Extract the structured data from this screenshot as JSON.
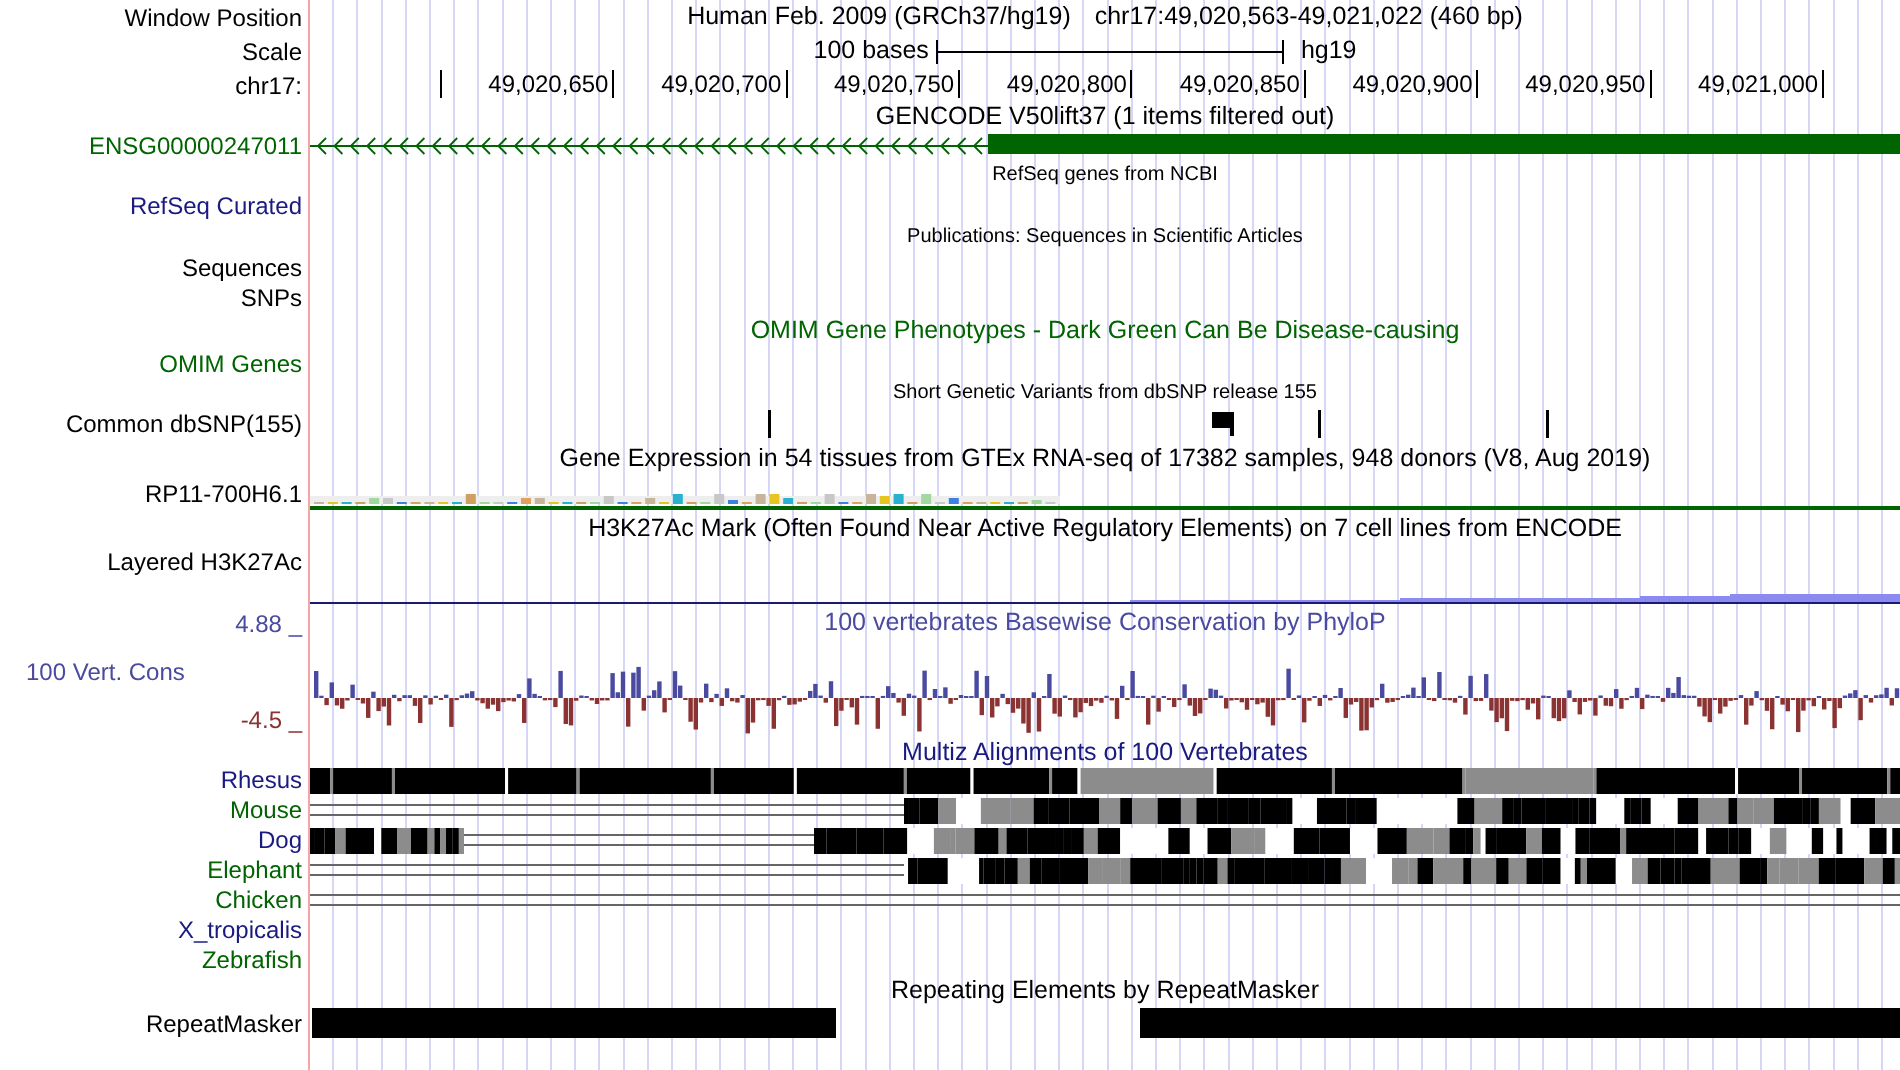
{
  "header": {
    "label": "Window Position",
    "assembly": "Human Feb. 2009 (GRCh37/hg19)",
    "position": "chr17:49,020,563-49,021,022 (460 bp)"
  },
  "scale": {
    "label": "Scale",
    "bar_label": "100 bases",
    "assembly": "hg19"
  },
  "ruler": {
    "label": "chr17:",
    "ticks": [
      "49,020,650",
      "49,020,700",
      "49,020,750",
      "49,020,800",
      "49,020,850",
      "49,020,900",
      "49,020,950",
      "49,021,000"
    ]
  },
  "rows": [
    {
      "kind": "title",
      "title": "GENCODE V50lift37 (1 items filtered out)"
    },
    {
      "kind": "gene",
      "label": "ENSG00000247011",
      "color": "#006400"
    },
    {
      "kind": "small_title",
      "title": "RefSeq genes from NCBI"
    },
    {
      "kind": "label",
      "label": "RefSeq Curated",
      "color": "#1a1a80"
    },
    {
      "kind": "small_title",
      "title": "Publications: Sequences in Scientific Articles"
    },
    {
      "kind": "label",
      "label": "Sequences",
      "color": "#000000"
    },
    {
      "kind": "label",
      "label": "SNPs",
      "color": "#000000"
    },
    {
      "kind": "title",
      "title": "OMIM Gene Phenotypes - Dark Green Can Be Disease-causing",
      "color": "#006400"
    },
    {
      "kind": "label",
      "label": "OMIM Genes",
      "color": "#006400"
    },
    {
      "kind": "small_title",
      "title": "Short Genetic Variants from dbSNP release 155"
    },
    {
      "kind": "snps",
      "label": "Common dbSNP(155)",
      "color": "#000000"
    },
    {
      "kind": "title",
      "title": "Gene Expression in 54 tissues from GTEx RNA-seq of 17382 samples, 948 donors (V8, Aug 2019)"
    },
    {
      "kind": "expression",
      "label": "RP11-700H6.1",
      "color": "#000000"
    },
    {
      "kind": "title",
      "title": "H3K27Ac Mark (Often Found Near Active Regulatory Elements) on 7 cell lines from ENCODE"
    },
    {
      "kind": "layered",
      "label": "Layered H3K27Ac",
      "color": "#000000"
    },
    {
      "kind": "wiggle",
      "title": "100 vertebrates Basewise Conservation by PhyloP",
      "label": "100 Vert. Cons",
      "axis_max": "4.88 _",
      "axis_min": "-4.5 _",
      "color": "#4a4aa0"
    },
    {
      "kind": "alignment",
      "title": "Multiz Alignments of 100 Vertebrates",
      "color": "#1a1a80",
      "species": [
        {
          "name": "Rhesus",
          "color": "#1a1a80",
          "kind": "full"
        },
        {
          "name": "Mouse",
          "color": "#006400",
          "kind": "partial"
        },
        {
          "name": "Dog",
          "color": "#1a1a80",
          "kind": "split"
        },
        {
          "name": "Elephant",
          "color": "#006400",
          "kind": "partial"
        },
        {
          "name": "Chicken",
          "color": "#006400",
          "kind": "lines"
        },
        {
          "name": "X_tropicalis",
          "color": "#1a1a80",
          "kind": "empty"
        },
        {
          "name": "Zebrafish",
          "color": "#006400",
          "kind": "empty"
        }
      ]
    },
    {
      "kind": "title",
      "title": "Repeating Elements by RepeatMasker"
    },
    {
      "kind": "repeats",
      "label": "RepeatMasker",
      "color": "#000000"
    }
  ]
}
